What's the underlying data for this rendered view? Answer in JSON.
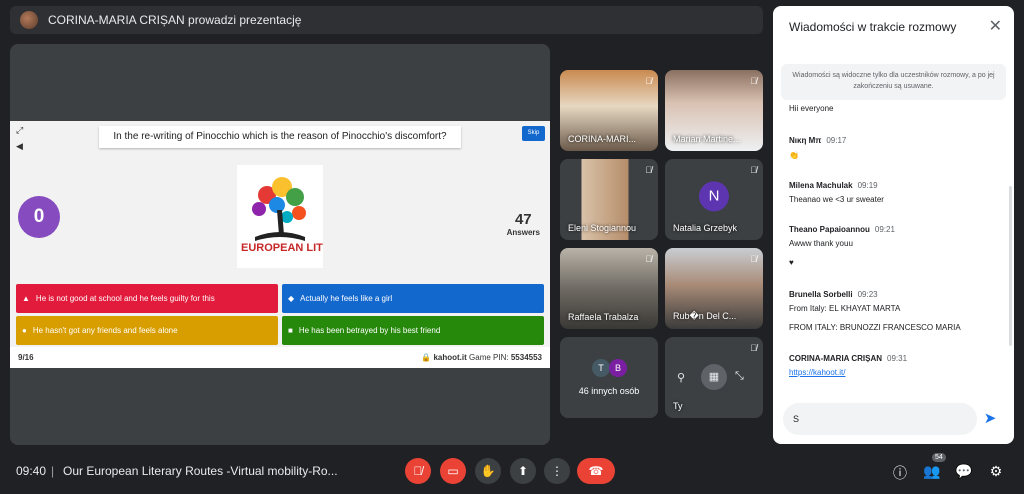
{
  "banner": {
    "text": "CORINA-MARIA CRIȘAN prowadzi prezentację"
  },
  "slide": {
    "question": "In the re-writing of Pinocchio which is the reason of Pinocchio's discomfort?",
    "skip": "Skip",
    "timer": "0",
    "answers_count": "47",
    "answers_label": "Answers",
    "logo_text": "EUROPEAN LITERARY",
    "options": [
      {
        "label": "He is not good at school and he feels guilty for this",
        "color": "#e21b3c",
        "symbol": "▲"
      },
      {
        "label": "Actually he feels like a girl",
        "color": "#1368ce",
        "symbol": "◆"
      },
      {
        "label": "He hasn't got any friends and feels alone",
        "color": "#d89e00",
        "symbol": "●"
      },
      {
        "label": "He has been betrayed by his best friend",
        "color": "#26890c",
        "symbol": "■"
      }
    ],
    "progress": "9/16",
    "site": "kahoot.it",
    "pin_label": "Game PIN:",
    "pin": "5534553"
  },
  "tiles": [
    {
      "name": "CORINA-MARI..."
    },
    {
      "name": "Marian Martine..."
    },
    {
      "name": "Eleni Stogiannou"
    },
    {
      "name": "Natalia Grzebyk",
      "initial": "N"
    },
    {
      "name": "Raffaela Trabalza"
    },
    {
      "name": "Rub�n Del C..."
    },
    {
      "name": "46 innych osób",
      "initials": [
        "T",
        "B"
      ]
    },
    {
      "name": "Ty"
    }
  ],
  "chat": {
    "title": "Wiadomości w trakcie rozmowy",
    "note": "Wiadomości są widoczne tylko dla uczestników rozmowy, a po jej zakończeniu są usuwane.",
    "messages": [
      {
        "text": "Hii everyone"
      },
      {
        "who": "Νικη Μπ",
        "time": "09:17",
        "text": "👏"
      },
      {
        "who": "Milena Machulak",
        "time": "09:19",
        "text": "Theanao we <3 ur sweater"
      },
      {
        "who": "Theano Papaioannou",
        "time": "09:21",
        "text": "Awww thank youu"
      },
      {
        "text": "♥"
      },
      {
        "who": "Brunella Sorbelli",
        "time": "09:23",
        "text": "From Italy: EL KHAYAT MARTA"
      },
      {
        "text": "FROM ITALY: BRUNOZZI FRANCESCO MARIA"
      },
      {
        "who": "CORINA-MARIA CRIȘAN",
        "time": "09:31",
        "text": "https://kahoot.it/"
      }
    ],
    "input_value": "S"
  },
  "bottom": {
    "clock": "09:40",
    "separator": "|",
    "meeting_title": "Our European Literary Routes -Virtual mobility-Ro...",
    "people_count": "54"
  },
  "colors": {
    "accent": "#1a73e8",
    "danger": "#ea4335",
    "background": "#202124",
    "timer": "#864cbf"
  }
}
